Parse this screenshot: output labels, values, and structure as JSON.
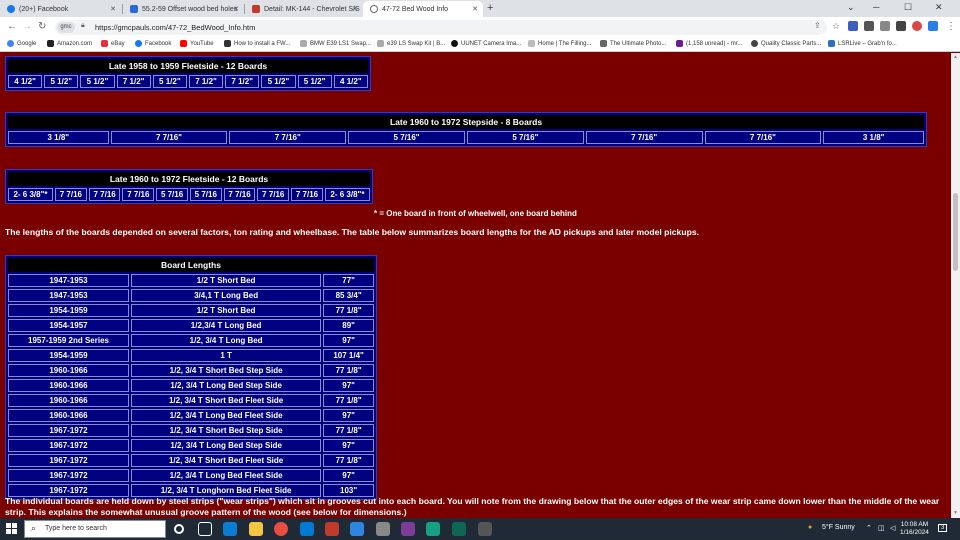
{
  "browser": {
    "tabs": [
      {
        "title": "(20+) Facebook",
        "active": false
      },
      {
        "title": "55.2-59 Offset wood bed holes",
        "active": false
      },
      {
        "title": "Detail: MK-144 - Chevrolet S/S",
        "active": false
      },
      {
        "title": "47-72 Bed Wood Info",
        "active": true
      }
    ],
    "new_tab": "+",
    "url": "https://gmcpauls.com/47-72_BedWood_Info.htm",
    "site_chip": "gmc",
    "bookmarks": [
      "Google",
      "Amazon.com",
      "eBay",
      "Facebook",
      "YouTube",
      "How to install a FW...",
      "BMW E39 LS1 Swap...",
      "e39 LS Swap Kit | B...",
      "UUNET Camera Ima...",
      "Home | The Filling...",
      "The Ultimate Photo...",
      "(1,158 unread) - mr...",
      "Quality Classic Parts...",
      "LSRLive – Grab'n fo..."
    ]
  },
  "page": {
    "table_1959": {
      "title": "Late 1958 to 1959 Fleetside - 12 Boards",
      "cells": [
        "4 1/2\"",
        "5 1/2\"",
        "5 1/2\"",
        "7 1/2\"",
        "5 1/2\"",
        "7 1/2\"",
        "7 1/2\"",
        "5 1/2\"",
        "5 1/2\"",
        "4 1/2\""
      ]
    },
    "table_stepside": {
      "title": "Late 1960 to 1972 Stepside - 8 Boards",
      "cells": [
        "3 1/8\"",
        "7 7/16\"",
        "7 7/16\"",
        "5 7/16\"",
        "5 7/16\"",
        "7 7/16\"",
        "7 7/16\"",
        "3 1/8\""
      ]
    },
    "table_fleetside": {
      "title": "Late 1960 to 1972 Fleetside - 12 Boards",
      "cells": [
        "2- 6 3/8\"*",
        "7 7/16",
        "7 7/16",
        "7 7/16",
        "5 7/16",
        "5 7/16",
        "7 7/16",
        "7 7/16",
        "7 7/16",
        "2- 6 3/8\"*"
      ]
    },
    "footnote": "* = One board in front of wheelwell, one board behind",
    "intro": "The lengths of the boards depended on several factors, ton rating and wheelbase. The table below summarizes board lengths for the AD pickups and  later model pickups.",
    "lengths_table": {
      "title": "Board Lengths",
      "rows": [
        [
          "1947-1953",
          "1/2 T Short Bed",
          "77\""
        ],
        [
          "1947-1953",
          "3/4,1 T Long Bed",
          "85 3/4\""
        ],
        [
          "1954-1959",
          "1/2 T Short Bed",
          "77 1/8\""
        ],
        [
          "1954-1957",
          "1/2,3/4 T Long Bed",
          "89\""
        ],
        [
          "1957-1959 2nd Series",
          "1/2, 3/4 T Long Bed",
          "97\""
        ],
        [
          "1954-1959",
          "1 T",
          "107 1/4\""
        ],
        [
          "1960-1966",
          "1/2, 3/4 T Short Bed Step Side",
          "77 1/8\""
        ],
        [
          "1960-1966",
          "1/2, 3/4 T Long Bed Step Side",
          "97\""
        ],
        [
          "1960-1966",
          "1/2, 3/4 T Short Bed Fleet Side",
          "77 1/8\""
        ],
        [
          "1960-1966",
          "1/2, 3/4 T Long Bed Fleet Side",
          "97\""
        ],
        [
          "1967-1972",
          "1/2, 3/4 T Short Bed Step Side",
          "77 1/8\""
        ],
        [
          "1967-1972",
          "1/2, 3/4 T Long Bed Step Side",
          "97\""
        ],
        [
          "1967-1972",
          "1/2, 3/4 T Short Bed Fleet Side",
          "77 1/8\""
        ],
        [
          "1967-1972",
          "1/2, 3/4 T Long Bed Fleet Side",
          "97\""
        ],
        [
          "1967-1972",
          "1/2, 3/4 T Longhorn Bed Fleet Side",
          "103\""
        ]
      ]
    },
    "outro": "The individual boards are held down by steel strips (\"wear strips\") which sit in grooves cut into each board. You will note from the drawing below that the outer edges of the wear strip came down lower than the middle of the wear strip. This explains the somewhat unusual groove pattern of the wood (see below for dimensions.)"
  },
  "taskbar": {
    "search_placeholder": "Type here to search",
    "weather": "5°F  Sunny",
    "time": "10:08 AM",
    "date": "1/16/2024",
    "notification_count": "3"
  },
  "colors": {
    "page_bg": "#7a0000",
    "table_bg": "#000080",
    "header_bg": "#000000"
  }
}
